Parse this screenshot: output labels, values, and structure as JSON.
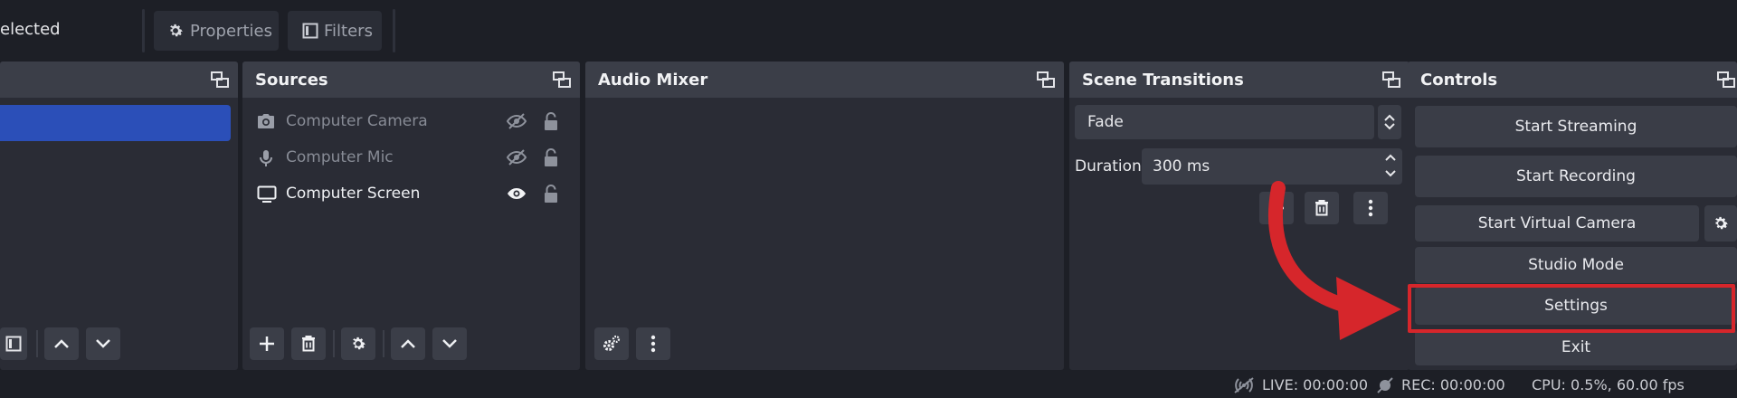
{
  "top_bar": {
    "selection_text": "elected",
    "properties_label": "Properties",
    "filters_label": "Filters"
  },
  "docks": {
    "scenes": {},
    "sources": {
      "title": "Sources",
      "items": [
        {
          "label": "Computer Camera",
          "icon": "camera-icon",
          "visible": false
        },
        {
          "label": "Computer Mic",
          "icon": "microphone-icon",
          "visible": false
        },
        {
          "label": "Computer Screen",
          "icon": "monitor-icon",
          "visible": true
        }
      ]
    },
    "audio_mixer": {
      "title": "Audio Mixer"
    },
    "scene_transitions": {
      "title": "Scene Transitions",
      "transition_value": "Fade",
      "duration_label": "Duration",
      "duration_value": "300 ms"
    },
    "controls": {
      "title": "Controls",
      "buttons": {
        "start_streaming": "Start Streaming",
        "start_recording": "Start Recording",
        "start_virtual_camera": "Start Virtual Camera",
        "studio_mode": "Studio Mode",
        "settings": "Settings",
        "exit": "Exit"
      }
    }
  },
  "status_bar": {
    "live": "LIVE: 00:00:00",
    "rec": "REC: 00:00:00",
    "cpu": "CPU: 0.5%, 60.00 fps"
  },
  "colors": {
    "accent_selection": "#2b4fb8",
    "annotation_red": "#d6262b",
    "panel_header": "#3b3e48",
    "panel_body": "#2a2c35"
  }
}
